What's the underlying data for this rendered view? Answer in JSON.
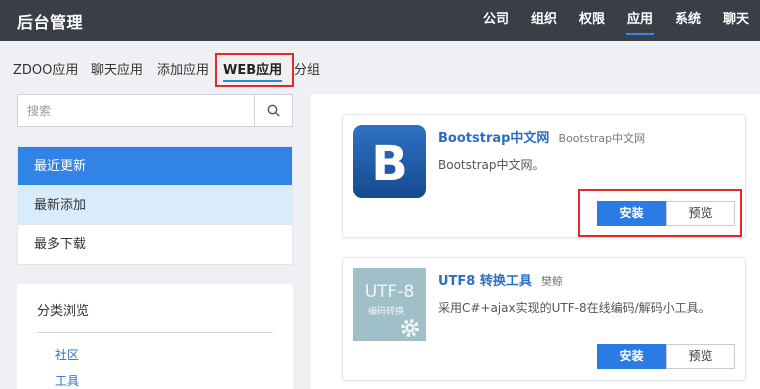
{
  "topbar": {
    "brand": "后台管理",
    "nav": [
      {
        "label": "公司",
        "active": false
      },
      {
        "label": "组织",
        "active": false
      },
      {
        "label": "权限",
        "active": false
      },
      {
        "label": "应用",
        "active": true
      },
      {
        "label": "系统",
        "active": false
      },
      {
        "label": "聊天",
        "active": false
      }
    ]
  },
  "subnav": {
    "items": [
      "ZDOO应用",
      "聊天应用",
      "添加应用",
      "WEB应用",
      "分组"
    ],
    "active_index": 3
  },
  "sidebar": {
    "search_placeholder": "搜索",
    "menu": [
      "最近更新",
      "最新添加",
      "最多下载"
    ],
    "category": {
      "title": "分类浏览",
      "links": [
        "社区",
        "工具"
      ]
    }
  },
  "apps": [
    {
      "name": "Bootstrap中文网",
      "author": "Bootstrap中文网",
      "description": "Bootstrap中文网。",
      "thumb_letter": "B",
      "install_label": "安装",
      "preview_label": "预览"
    },
    {
      "name": "UTF8 转换工具",
      "author": "樊鲸",
      "description": "采用C#+ajax实现的UTF-8在线编码/解码小工具。",
      "thumb_text": "UTF-8",
      "thumb_subtext": "编码转换",
      "install_label": "安装",
      "preview_label": "预览"
    }
  ],
  "colors": {
    "topbar_bg": "#3a3f47",
    "accent": "#2a7be4",
    "highlight": "#e32929"
  }
}
